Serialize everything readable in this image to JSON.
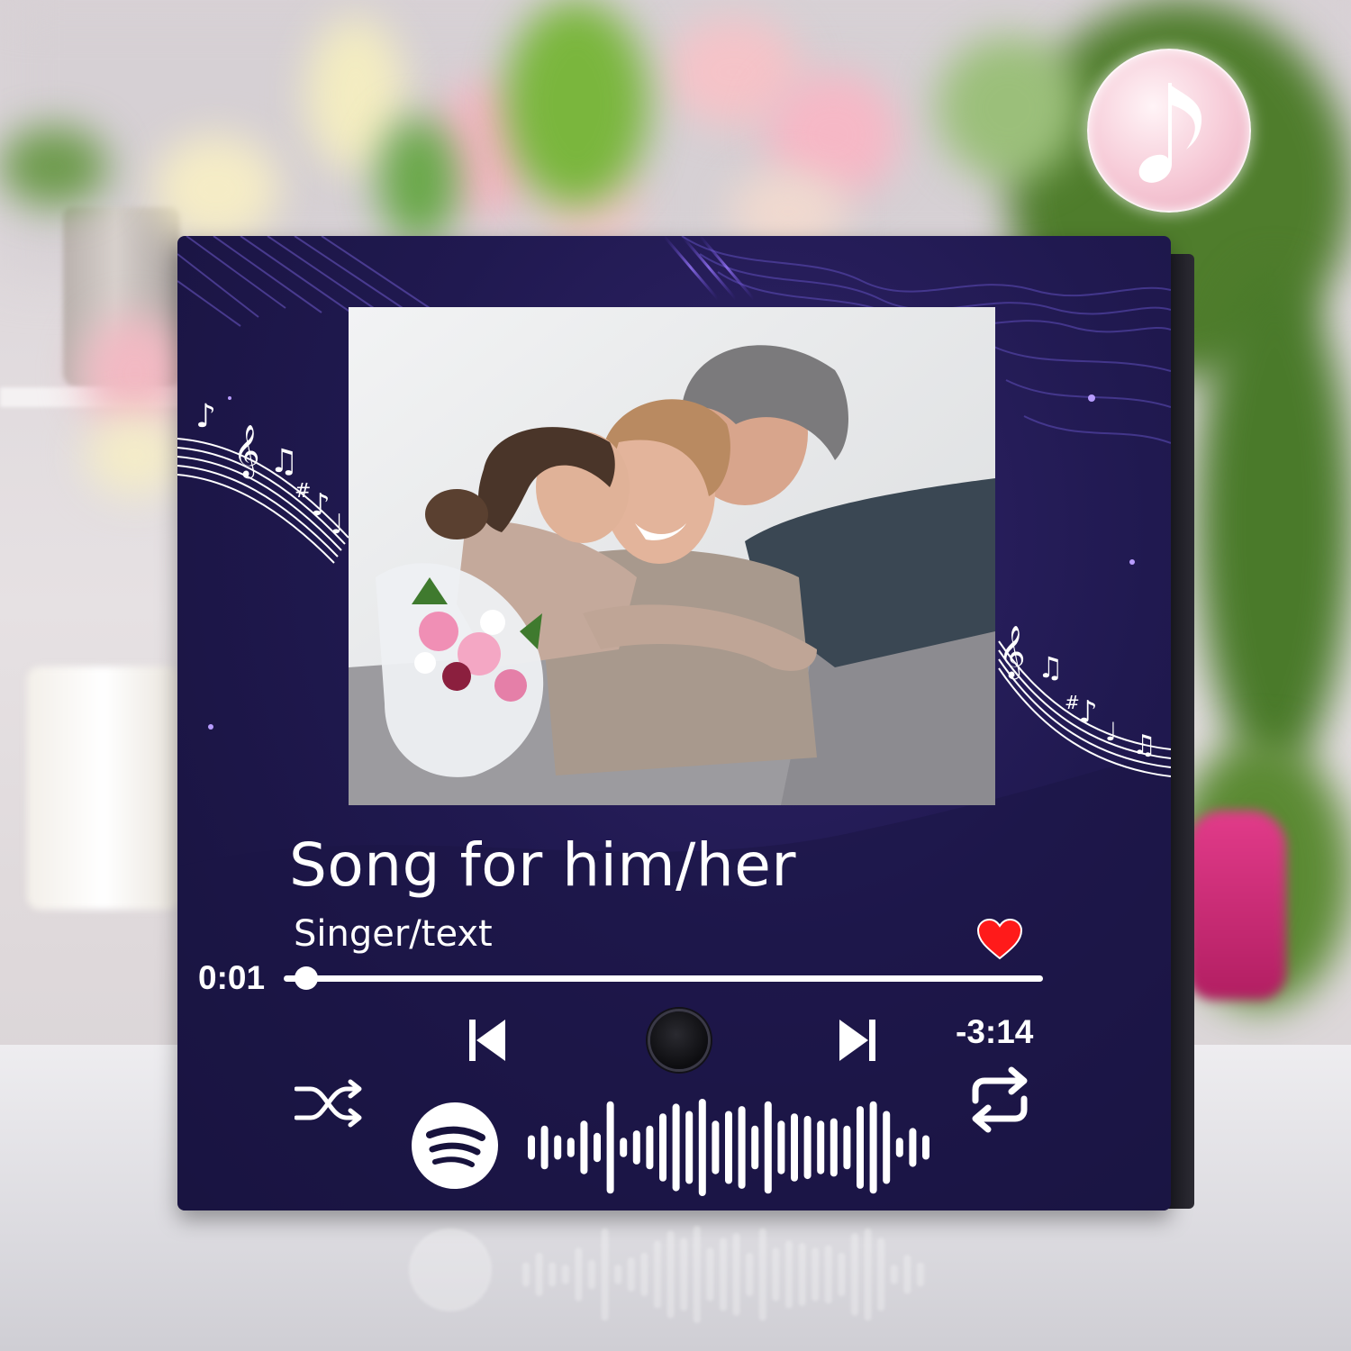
{
  "product": {
    "song_title": "Song for him/her",
    "artist": "Singer/text",
    "time_elapsed": "0:01",
    "time_remaining": "-3:14",
    "progress_fraction": 0.03,
    "liked": true
  },
  "icons": {
    "badge": "music-note-icon",
    "like": "heart-icon",
    "previous": "skip-previous-icon",
    "next": "skip-next-icon",
    "shuffle": "shuffle-icon",
    "repeat": "repeat-icon",
    "logo": "spotify-logo-icon",
    "scan_code": "spotify-code-icon"
  },
  "colors": {
    "plaque_background": "#201950",
    "heart": "#ff1a1a",
    "text": "#ffffff",
    "spotify_code_bars": [
      0.25,
      0.45,
      0.25,
      0.2,
      0.55,
      0.3,
      0.95,
      0.2,
      0.35,
      0.45,
      0.7,
      0.9,
      0.75,
      1.0,
      0.55,
      0.75,
      0.85,
      0.45,
      0.95,
      0.55,
      0.7,
      0.65,
      0.55,
      0.6,
      0.45,
      0.85,
      0.95,
      0.75,
      0.2,
      0.4,
      0.25
    ]
  }
}
